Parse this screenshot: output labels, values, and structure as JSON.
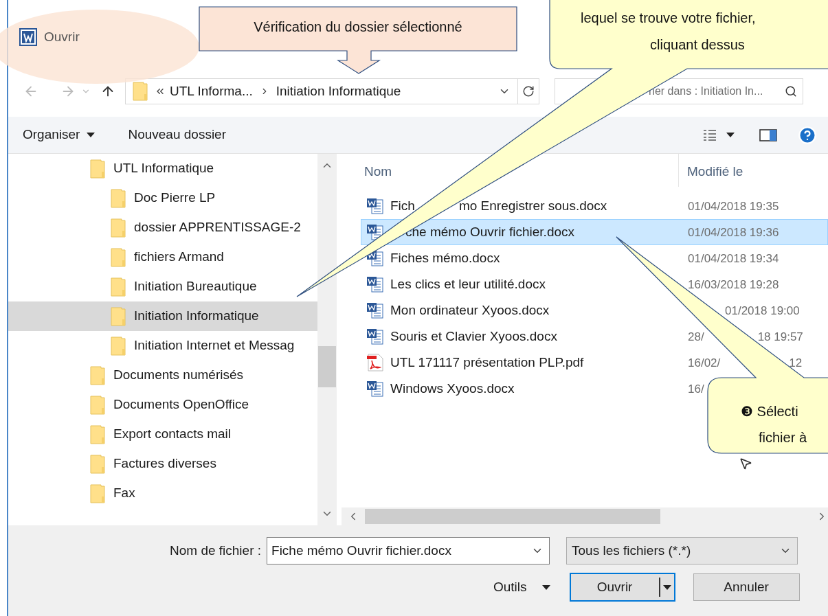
{
  "window": {
    "title": "Ouvrir"
  },
  "callouts": [
    {
      "kind": "arrow_box",
      "lines": [
        "Vérification du dossier sélectionné"
      ]
    },
    {
      "kind": "bubble",
      "lines": [
        "lequel se trouve votre fichier,",
        "cliquant dessus"
      ]
    },
    {
      "kind": "bubble",
      "lines": [
        "❸ Sélecti",
        "fichier à"
      ]
    }
  ],
  "address_bar": {
    "segments": [
      "UTL Informa...",
      "Initiation Informatique"
    ]
  },
  "search": {
    "placeholder": "her dans : Initiation In..."
  },
  "toolbar": {
    "buttons": [
      "Organiser",
      "Nouveau dossier"
    ]
  },
  "tree": {
    "items": [
      {
        "label": "UTL Informatique",
        "selected": false,
        "children": [
          {
            "label": "Doc Pierre LP",
            "selected": false
          },
          {
            "label": "dossier APPRENTISSAGE-2",
            "selected": false
          },
          {
            "label": "fichiers Armand",
            "selected": false
          },
          {
            "label": "Initiation Bureautique",
            "selected": false
          },
          {
            "label": "Initiation Informatique",
            "selected": true
          },
          {
            "label": "Initiation Internet et Messag",
            "selected": false
          }
        ]
      },
      {
        "label": "Documents numérisés",
        "selected": false
      },
      {
        "label": "Documents OpenOffice",
        "selected": false
      },
      {
        "label": "Export contacts mail",
        "selected": false
      },
      {
        "label": "Factures diverses",
        "selected": false
      },
      {
        "label": "Fax",
        "selected": false
      }
    ]
  },
  "files": {
    "columns": [
      "Nom",
      "Modifié le"
    ],
    "rows": [
      {
        "kind": "word",
        "name": [
          "Fich",
          "mo Enregistrer sous.docx"
        ],
        "date": [
          "01/04/2018 19:35"
        ],
        "selected": false
      },
      {
        "kind": "word",
        "name": [
          "che mémo Ouvrir fichier.docx"
        ],
        "date": [
          "01/04/2018 19:36"
        ],
        "selected": true
      },
      {
        "kind": "word",
        "name": [
          "Fiches mémo.docx"
        ],
        "date": [
          "01/04/2018 19:34"
        ],
        "selected": false
      },
      {
        "kind": "word",
        "name": [
          "Les clics et leur utilité.docx"
        ],
        "date": [
          "16/03/2018 19:28"
        ],
        "selected": false
      },
      {
        "kind": "word",
        "name": [
          "Mon ordinateur Xyoos.docx"
        ],
        "date": [
          "01/2018 19:00"
        ],
        "selected": false
      },
      {
        "kind": "word",
        "name": [
          "Souris et Clavier Xyoos.docx"
        ],
        "date": [
          "28/",
          "18 19:57"
        ],
        "selected": false
      },
      {
        "kind": "pdf",
        "name": [
          "UTL 171117 présentation PLP.pdf"
        ],
        "date": [
          "16/02/",
          "12"
        ],
        "selected": false
      },
      {
        "kind": "word",
        "name": [
          "Windows Xyoos.docx"
        ],
        "date": [
          "16/"
        ],
        "selected": false
      }
    ]
  },
  "footer": {
    "filename_label": "Nom de fichier :",
    "filename_value": "Fiche mémo Ouvrir fichier.docx",
    "filter": "Tous les fichiers (*.*)",
    "tools": "Outils",
    "open": "Ouvrir",
    "cancel": "Annuler"
  }
}
